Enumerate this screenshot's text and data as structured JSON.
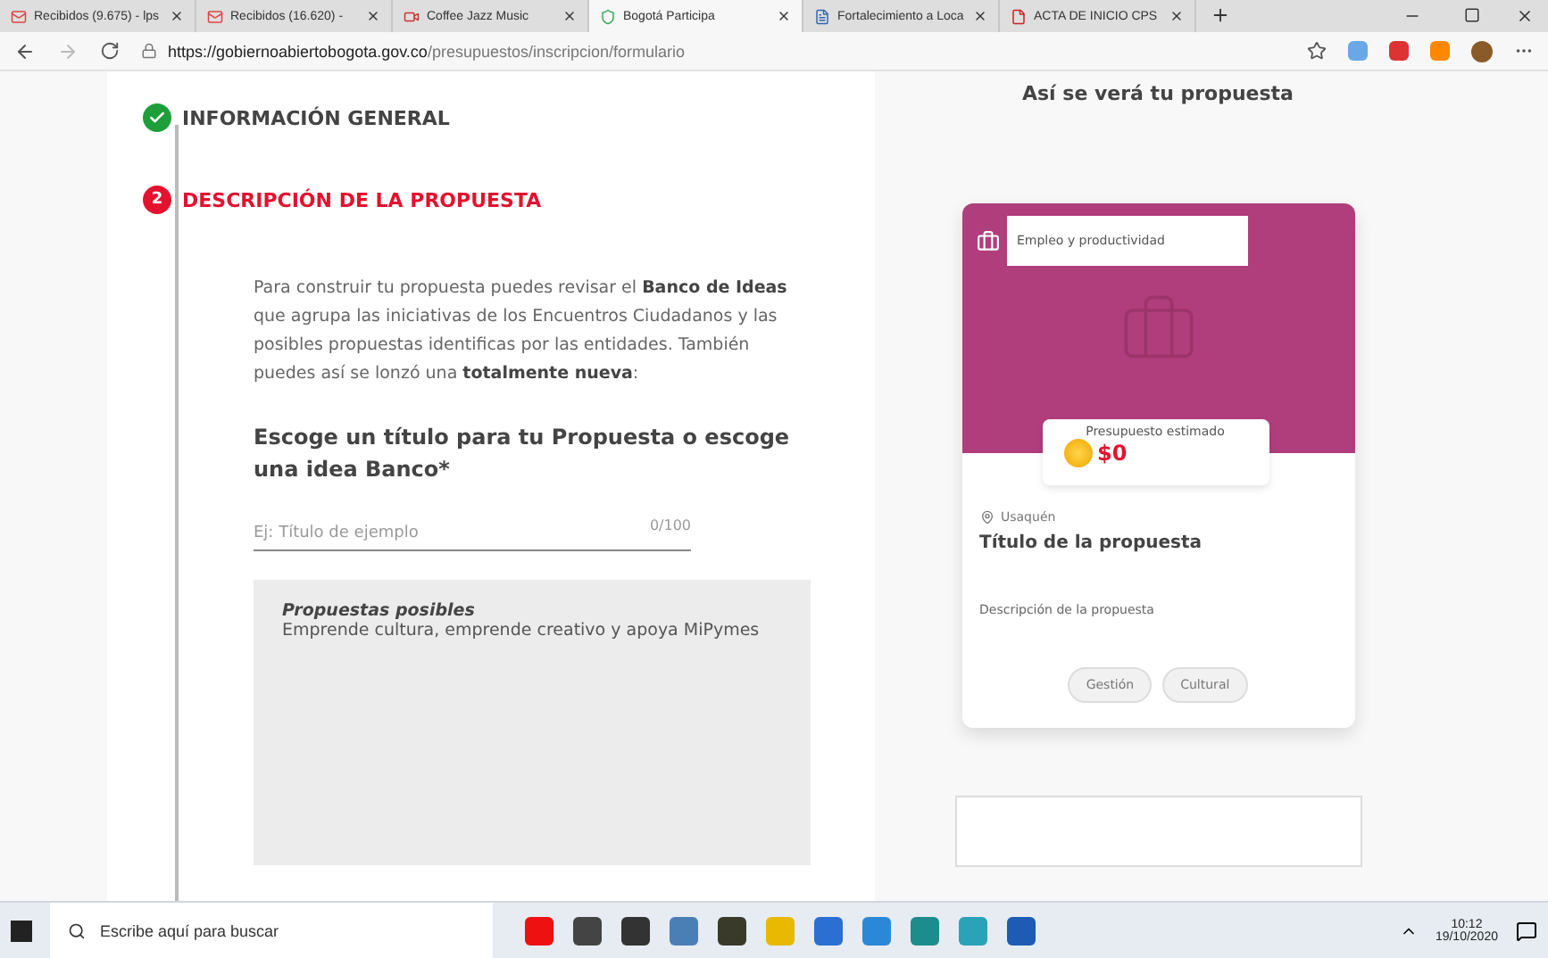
{
  "browser": {
    "tabs": [
      {
        "title": "Recibidos (9.675) - lps",
        "kind": "mail",
        "selected": false
      },
      {
        "title": "Recibidos (16.620) -",
        "kind": "mail",
        "selected": false
      },
      {
        "title": "Coffee Jazz Music",
        "kind": "video",
        "selected": false
      },
      {
        "title": "Bogotá Participa",
        "kind": "shield",
        "selected": true
      },
      {
        "title": "Fortalecimiento a Loca",
        "kind": "doc",
        "selected": false
      },
      {
        "title": "ACTA DE INICIO CPS",
        "kind": "pdf",
        "selected": false
      }
    ],
    "url": {
      "host": "https://gobiernoabiertobogota.gov.co",
      "path": "/presupuestos/inscripcion/formulario"
    }
  },
  "form": {
    "steps": [
      {
        "label": "INFORMACIÓN GENERAL",
        "completed": true
      },
      {
        "label": "DESCRIPCIÓN DE LA PROPUESTA",
        "completed": false,
        "number": "2"
      }
    ],
    "intro": "Para construir tu propuesta puedes revisar el **Banco de Ideas** que agrupa las iniciativas de los Encuentros Ciudadanos y las posibles propuestas identificas por las entidades. También puedes así se lonzó una **totalmente nueva**:",
    "question": "Escoge un título para tu Propuesta o escoge una idea Banco*",
    "title_field": {
      "placeholder": "Ej: Título de ejemplo",
      "counter": "0/100"
    },
    "suggestions": {
      "title": "Propuestas posibles",
      "items": [
        "Emprende cultura, emprende creativo y apoya MiPymes"
      ]
    }
  },
  "preview": {
    "heading": "Así se verá tu propuesta",
    "card": {
      "category": "Empleo y productividad",
      "budget_label": "Presupuesto estimado",
      "budget": "$0",
      "location": "Usaquén",
      "title": "Título de la propuesta",
      "description": "Descripción de la propuesta",
      "tags": [
        "Gestión",
        "Cultural"
      ]
    }
  },
  "taskbar": {
    "search_placeholder": "Escribe aquí para buscar",
    "time": "10:12",
    "date": "19/10/2020"
  }
}
